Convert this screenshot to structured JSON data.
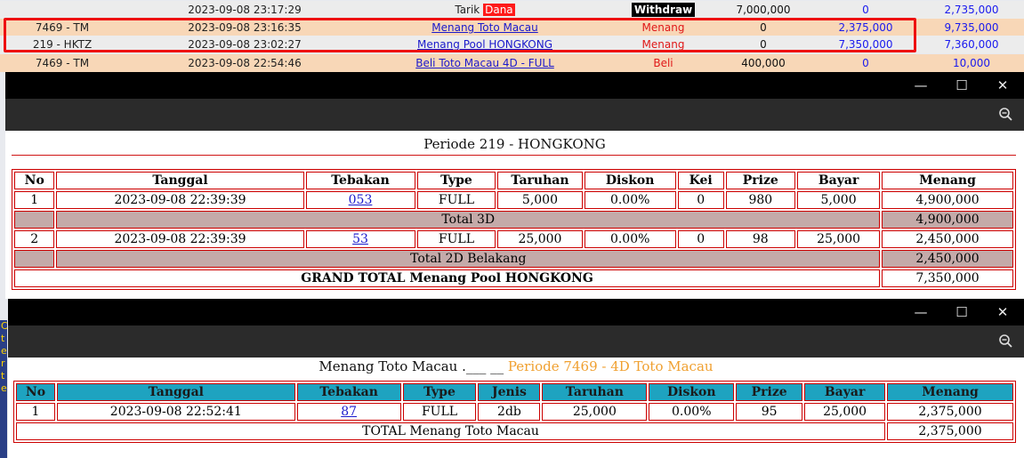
{
  "background": {
    "rows": [
      {
        "user": "",
        "date": "2023-09-08 23:17:29",
        "desc_prefix": "Tarik",
        "desc_tag": "Dana",
        "status": "Withdraw",
        "amount1": "7,000,000",
        "amount2": "0",
        "amount3": "2,735,000"
      },
      {
        "user": "7469 - TM",
        "date": "2023-09-08 23:16:35",
        "desc": "Menang Toto Macau",
        "status": "Menang",
        "amount1": "0",
        "amount2": "2,375,000",
        "amount3": "9,735,000"
      },
      {
        "user": "219 - HKTZ",
        "date": "2023-09-08 23:02:27",
        "desc": "Menang Pool HONGKONG",
        "status": "Menang",
        "amount1": "0",
        "amount2": "7,350,000",
        "amount3": "7,360,000"
      },
      {
        "user": "7469 - TM",
        "date": "2023-09-08 22:54:46",
        "desc": "Beli Toto Macau 4D - FULL",
        "status": "Beli",
        "amount1": "400,000",
        "amount2": "0",
        "amount3": "10,000"
      }
    ],
    "left_strip_chars": [
      "C",
      "t",
      "e",
      "r",
      "t",
      "e"
    ]
  },
  "window_controls": {
    "minimize": "—",
    "maximize": "☐",
    "close": "✕"
  },
  "window1": {
    "heading": "Periode 219 - HONGKONG",
    "headers": [
      "No",
      "Tanggal",
      "Tebakan",
      "Type",
      "Taruhan",
      "Diskon",
      "Kei",
      "Prize",
      "Bayar",
      "Menang"
    ],
    "rows": [
      {
        "no": "1",
        "tanggal": "2023-09-08 22:39:39",
        "tebakan": "053",
        "type": "FULL",
        "taruhan": "5,000",
        "diskon": "0.00%",
        "kei": "0",
        "prize": "980",
        "bayar": "5,000",
        "menang": "4,900,000"
      },
      {
        "no": "2",
        "tanggal": "2023-09-08 22:39:39",
        "tebakan": "53",
        "type": "FULL",
        "taruhan": "25,000",
        "diskon": "0.00%",
        "kei": "0",
        "prize": "98",
        "bayar": "25,000",
        "menang": "2,450,000"
      }
    ],
    "total_3d_label": "Total 3D",
    "total_3d_value": "4,900,000",
    "total_2d_label": "Total 2D Belakang",
    "total_2d_value": "2,450,000",
    "grand_total_label": "GRAND TOTAL  Menang Pool HONGKONG",
    "grand_total_value": "7,350,000"
  },
  "window2": {
    "heading_main": "Menang Toto Macau  .___ __",
    "heading_period": "Periode 7469 - 4D Toto Macau",
    "headers": [
      "No",
      "Tanggal",
      "Tebakan",
      "Type",
      "Jenis",
      "Taruhan",
      "Diskon",
      "Prize",
      "Bayar",
      "Menang"
    ],
    "row": {
      "no": "1",
      "tanggal": "2023-09-08 22:52:41",
      "tebakan": "87",
      "type": "FULL",
      "jenis": "2db",
      "taruhan": "25,000",
      "diskon": "0.00%",
      "prize": "95",
      "bayar": "25,000",
      "menang": "2,375,000"
    },
    "total_label": "TOTAL  Menang Toto Macau",
    "total_value": "2,375,000"
  }
}
